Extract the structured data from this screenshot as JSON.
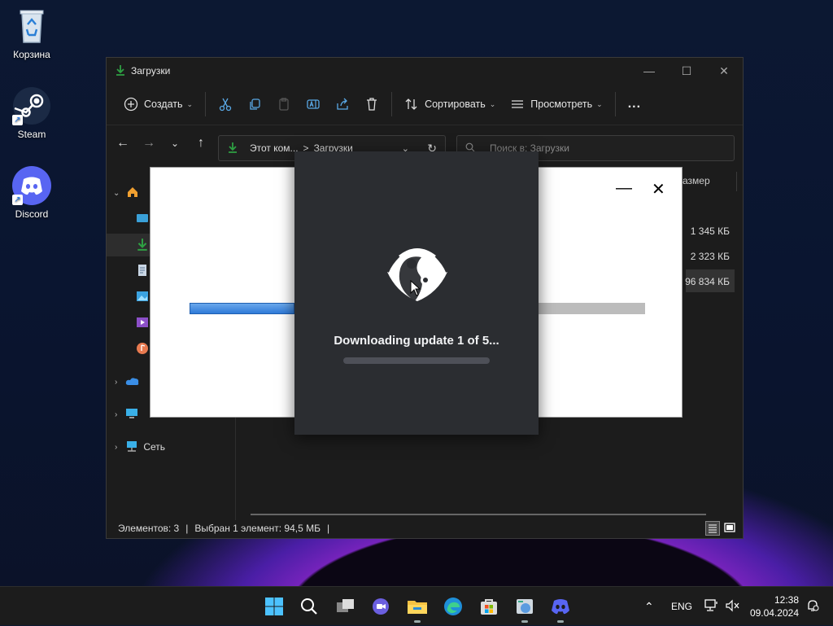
{
  "desktop": {
    "icons": [
      {
        "label": "Корзина"
      },
      {
        "label": "Steam"
      },
      {
        "label": "Discord"
      }
    ]
  },
  "explorer": {
    "title": "Загрузки",
    "toolbar": {
      "create": "Создать",
      "sort": "Сортировать",
      "view": "Просмотреть",
      "more": "..."
    },
    "address": {
      "crumb1": "Этот ком...",
      "sep": ">",
      "crumb2": "Загрузки"
    },
    "search_placeholder": "Поиск в: Загрузки",
    "sidebar": {
      "network": "Сеть"
    },
    "column_size": "азмер",
    "rows": [
      {
        "size": "1 345 КБ"
      },
      {
        "size": "2 323 КБ"
      },
      {
        "size": "96 834 КБ"
      }
    ],
    "status": {
      "items": "Элементов: 3",
      "sep": "|",
      "selected": "Выбран 1 элемент: 94,5 МБ"
    }
  },
  "installer": {
    "progress": 0.23
  },
  "updater": {
    "message": "Downloading update 1 of 5...",
    "progress": 0
  },
  "taskbar": {
    "lang": "ENG",
    "time": "12:38",
    "date": "09.04.2024"
  },
  "colors": {
    "accent": "#2f7ad8",
    "discord": "#5865f2",
    "download_green": "#2ea043"
  }
}
